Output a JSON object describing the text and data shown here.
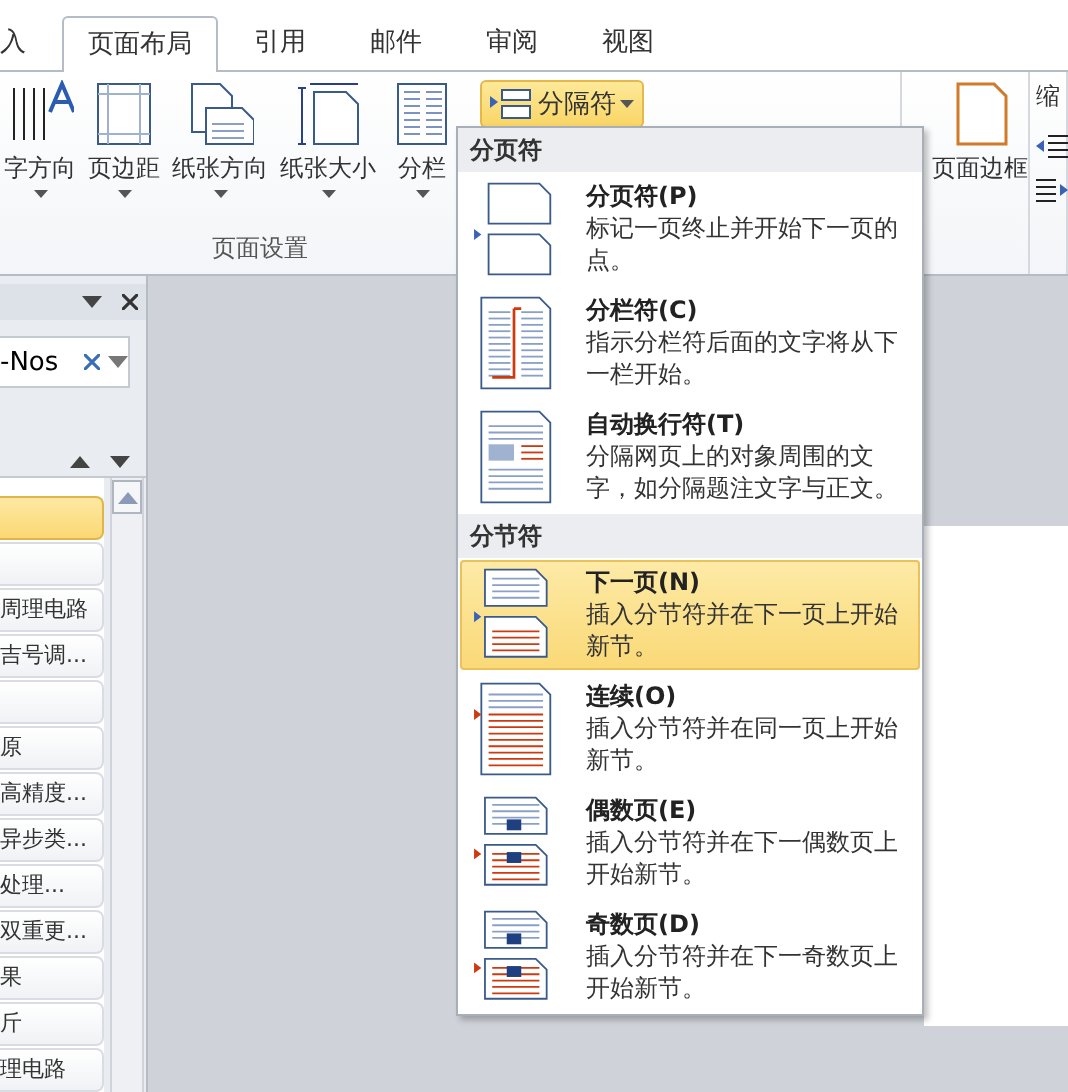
{
  "tabs": [
    {
      "label": "入",
      "selected": false
    },
    {
      "label": "页面布局",
      "selected": true
    },
    {
      "label": "引用",
      "selected": false
    },
    {
      "label": "邮件",
      "selected": false
    },
    {
      "label": "审阅",
      "selected": false
    },
    {
      "label": "视图",
      "selected": false
    }
  ],
  "page_setup": {
    "label": "页面设置",
    "buttons": [
      {
        "kind": "direction",
        "label": "字方向"
      },
      {
        "kind": "margins",
        "label": "页边距"
      },
      {
        "kind": "orientation",
        "label": "纸张方向"
      },
      {
        "kind": "size",
        "label": "纸张大小"
      },
      {
        "kind": "columns",
        "label": "分栏"
      }
    ],
    "breaks_button": {
      "label": "分隔符",
      "open": true
    }
  },
  "page_border": {
    "label": "页面边框"
  },
  "paragraph": {
    "label": "缩"
  },
  "pane": {
    "search": {
      "value": "-Nos"
    },
    "items": [
      {
        "selected": true
      },
      {
        "selected": false
      },
      {
        "selected": false,
        "text": "周理电路"
      },
      {
        "selected": false,
        "text": "吉号调..."
      },
      {
        "selected": false
      },
      {
        "selected": false,
        "text": "原"
      },
      {
        "selected": false,
        "text": "高精度..."
      },
      {
        "selected": false,
        "text": "异步类..."
      },
      {
        "selected": false,
        "text": "处理..."
      },
      {
        "selected": false,
        "text": "双重更..."
      },
      {
        "selected": false,
        "text": "果"
      },
      {
        "selected": false,
        "text": "斤"
      },
      {
        "selected": false,
        "text": "理电路"
      }
    ]
  },
  "menu": {
    "sections": [
      {
        "title": "分页符",
        "items": [
          {
            "kind": "page",
            "title": "分页符(P)",
            "description": "标记一页终止并开始下一页的点。",
            "selected": false
          },
          {
            "kind": "column",
            "title": "分栏符(C)",
            "description": "指示分栏符后面的文字将从下一栏开始。",
            "selected": false
          },
          {
            "kind": "wrap",
            "title": "自动换行符(T)",
            "description": "分隔网页上的对象周围的文字，如分隔题注文字与正文。",
            "selected": false
          }
        ]
      },
      {
        "title": "分节符",
        "items": [
          {
            "kind": "next",
            "title": "下一页(N)",
            "description": "插入分节符并在下一页上开始新节。",
            "selected": true
          },
          {
            "kind": "continuous",
            "title": "连续(O)",
            "description": "插入分节符并在同一页上开始新节。",
            "selected": false
          },
          {
            "kind": "even",
            "title": "偶数页(E)",
            "description": "插入分节符并在下一偶数页上开始新节。",
            "selected": false
          },
          {
            "kind": "odd",
            "title": "奇数页(D)",
            "description": "插入分节符并在下一奇数页上开始新节。",
            "selected": false
          }
        ]
      }
    ]
  }
}
